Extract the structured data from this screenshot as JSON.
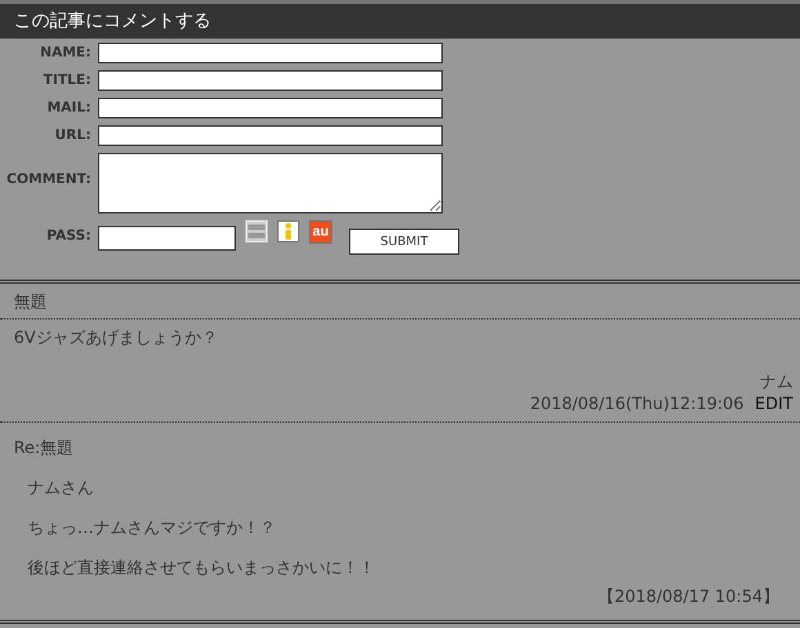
{
  "header": {
    "title": "この記事にコメントする"
  },
  "form": {
    "fields": [
      {
        "label": "NAME:",
        "kind": "text"
      },
      {
        "label": "TITLE:",
        "kind": "text"
      },
      {
        "label": "MAIL:",
        "kind": "text"
      },
      {
        "label": "URL:",
        "kind": "text"
      },
      {
        "label": "COMMENT:",
        "kind": "textarea"
      },
      {
        "label": "PASS:",
        "kind": "password"
      }
    ],
    "emoji_buttons": [
      {
        "kind": "lines"
      },
      {
        "kind": "i"
      },
      {
        "kind": "au",
        "text": "au"
      }
    ],
    "submit": "SUBMIT"
  },
  "comments": [
    {
      "title": "無題",
      "body": "6Vジャズあげましょうか？",
      "author": "ナム",
      "date": "2018/08/16(Thu)12:19:06",
      "edit": "EDIT",
      "reply": {
        "title": "Re:無題",
        "lines": [
          "ナムさん",
          "ちょっ…ナムさんマジですか！？",
          "後ほど直接連絡させてもらいまっさかいに！！"
        ],
        "date": "【2018/08/17 10:54】"
      }
    }
  ]
}
